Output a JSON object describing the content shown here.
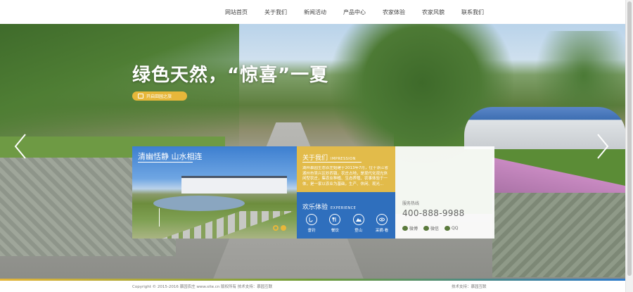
{
  "nav": {
    "items": [
      "网站首页",
      "关于我们",
      "新闻活动",
      "产品中心",
      "农家体验",
      "农家风貌",
      "联系我们"
    ]
  },
  "hero": {
    "title": "绿色天然，“惊喜”一夏",
    "button_label": "开启田园之旅"
  },
  "photo_card": {
    "title": "清幽恬静 山水相连"
  },
  "about": {
    "title": "关于我们",
    "subtitle": "IMPRESSION",
    "description": "湖州慕园生态农庄始建于2013年7月，位于浙江省湖州市吴兴区妙西镇，农庄占地，是现代化观光休闲型农庄，集农业种植、生态养殖、农事体验于一体，是一家以农业为基础，生产、休闲、观光..."
  },
  "experience": {
    "title": "欢乐体验",
    "subtitle": "EXPERIENCE",
    "items": [
      {
        "icon": "fishing-icon",
        "label": "垂钓"
      },
      {
        "icon": "dining-icon",
        "label": "餐饮"
      },
      {
        "icon": "climbing-icon",
        "label": "登山"
      },
      {
        "icon": "eye-icon",
        "label": "采摘·看"
      }
    ]
  },
  "contact": {
    "label": "服务热线",
    "phone": "400-888-9988",
    "social": [
      {
        "icon": "weibo-icon",
        "label": "微博"
      },
      {
        "icon": "wechat-icon",
        "label": "微信"
      },
      {
        "icon": "qq-icon",
        "label": "QQ"
      }
    ]
  },
  "footer": {
    "copyright": "Copyright © 2015-2016  慕园农庄  www.site.cn  版权所有    技术支持：慕园互联",
    "tech": "技术支持：慕园互联"
  },
  "colors": {
    "accent_yellow": "#e2bb4a",
    "accent_blue": "#2f6fbd",
    "accent_green": "#6f9c3a"
  }
}
